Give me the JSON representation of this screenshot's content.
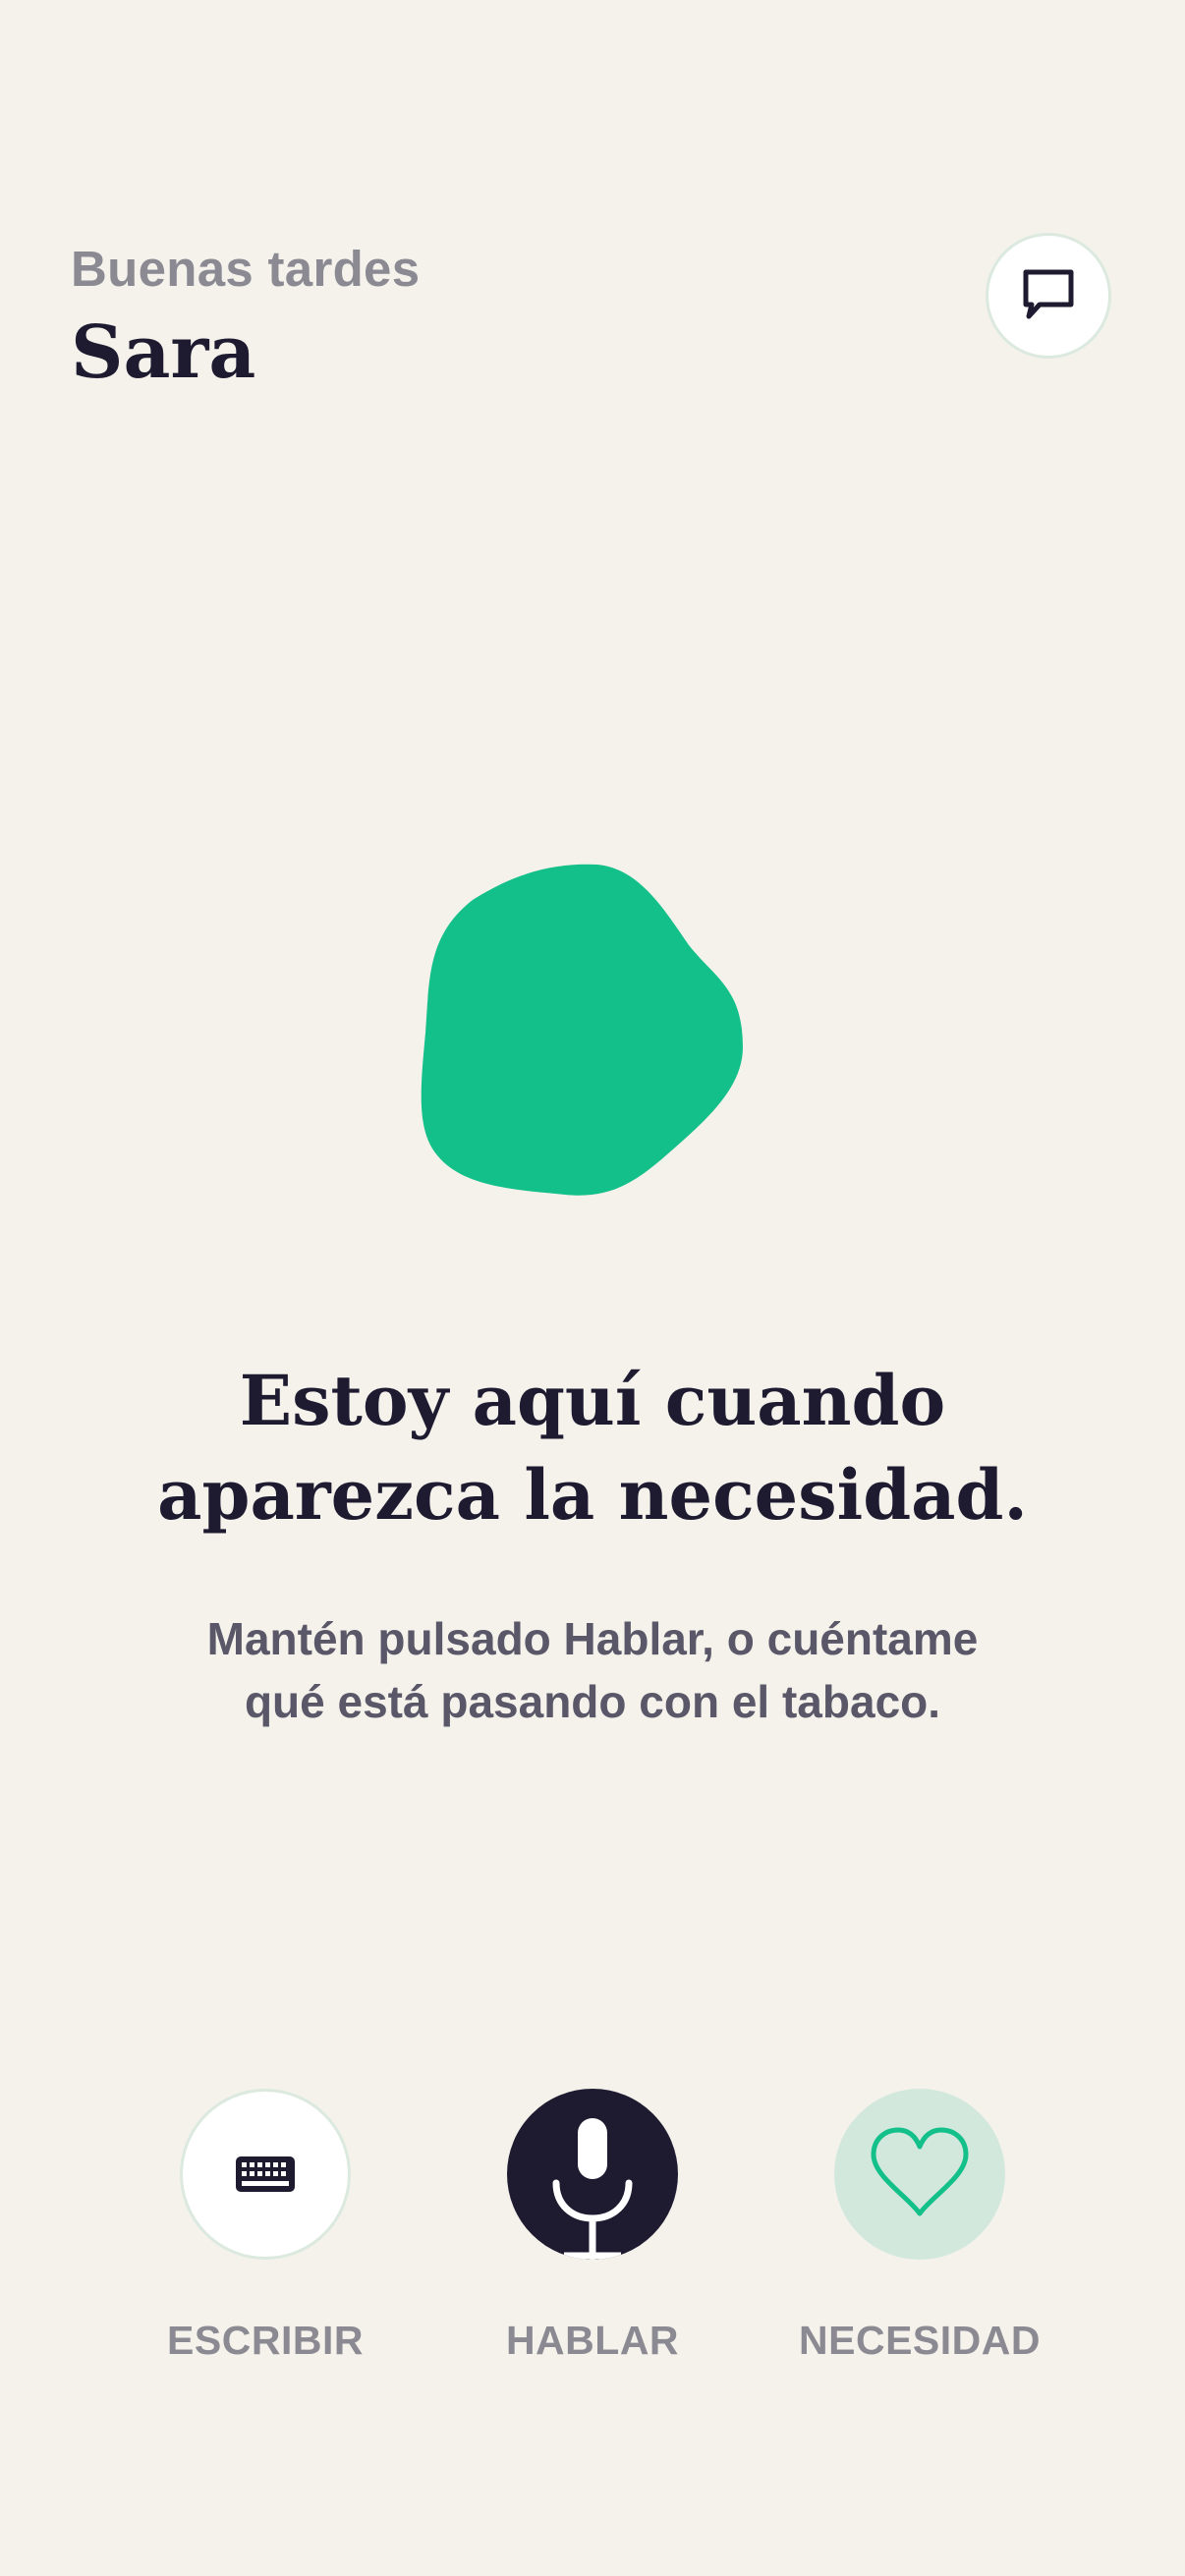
{
  "header": {
    "greeting": "Buenas tardes",
    "user_name": "Sara",
    "chat_icon": "chat-bubble-icon"
  },
  "hero": {
    "blob_color": "#14c08a",
    "headline_line1": "Estoy aquí cuando",
    "headline_line2": "aparezca la necesidad.",
    "subtext_line1": "Mantén pulsado Hablar, o cuéntame",
    "subtext_line2": "qué está pasando con el tabaco."
  },
  "actions": [
    {
      "label": "ESCRIBIR",
      "icon": "keyboard-icon"
    },
    {
      "label": "HABLAR",
      "icon": "microphone-icon"
    },
    {
      "label": "NECESIDAD",
      "icon": "heart-icon"
    }
  ],
  "colors": {
    "background": "#f5f2ec",
    "primary_dark": "#1e1b31",
    "accent_green": "#14c08a",
    "muted_text": "#8b8a93",
    "need_button_bg": "#d3e8dd"
  }
}
